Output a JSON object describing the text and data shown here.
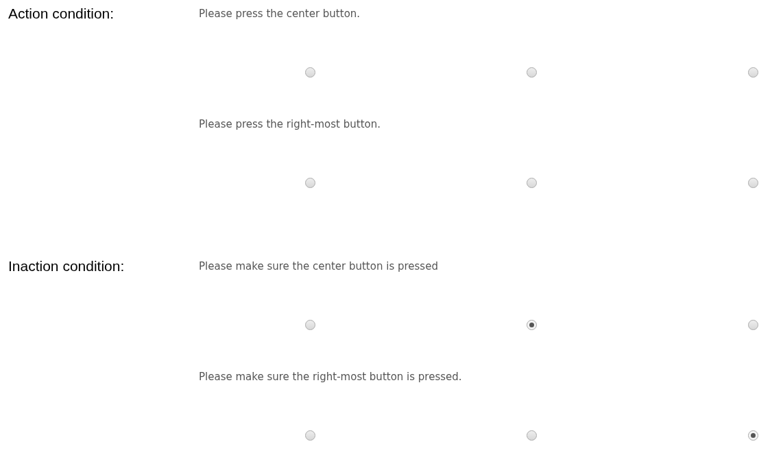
{
  "sections": [
    {
      "label": "Action condition:",
      "questions": [
        {
          "text": "Please press the center button.",
          "options": [
            {
              "selected": false
            },
            {
              "selected": false
            },
            {
              "selected": false
            }
          ]
        },
        {
          "text": "Please press the right-most button.",
          "options": [
            {
              "selected": false
            },
            {
              "selected": false
            },
            {
              "selected": false
            }
          ]
        }
      ]
    },
    {
      "label": "Inaction condition:",
      "questions": [
        {
          "text": "Please make sure the center button is pressed",
          "options": [
            {
              "selected": false
            },
            {
              "selected": true
            },
            {
              "selected": false
            }
          ]
        },
        {
          "text": "Please make sure the right-most button is pressed.",
          "options": [
            {
              "selected": false
            },
            {
              "selected": false
            },
            {
              "selected": true
            }
          ]
        }
      ]
    }
  ]
}
